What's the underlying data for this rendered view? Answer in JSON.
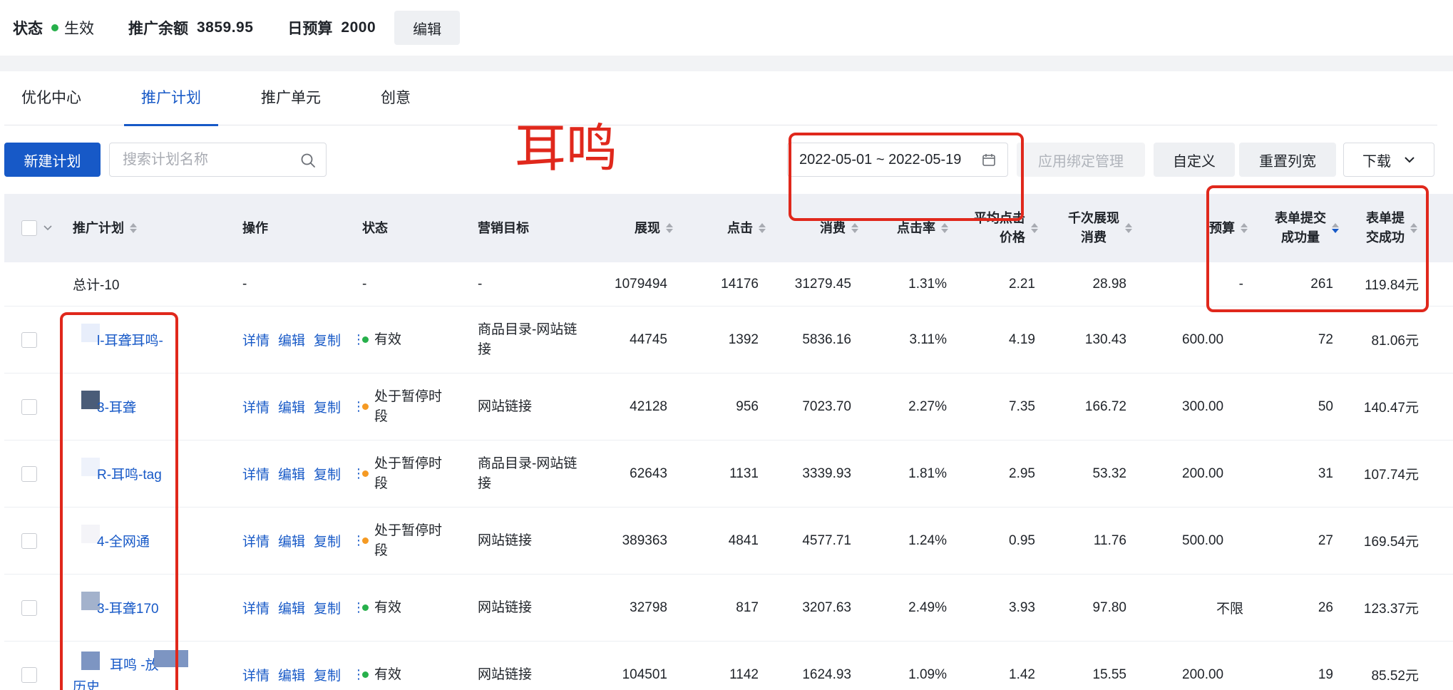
{
  "topbar": {
    "status_label": "状态",
    "status_value": "生效",
    "balance_label": "推广余额",
    "balance_value": "3859.95",
    "budget_label": "日预算",
    "budget_value": "2000",
    "edit_label": "编辑"
  },
  "tabs": [
    "优化中心",
    "推广计划",
    "推广单元",
    "创意"
  ],
  "toolbar": {
    "new_plan": "新建计划",
    "search_placeholder": "搜索计划名称",
    "date_range": "2022-05-01 ~ 2022-05-19",
    "app_binding": "应用绑定管理",
    "customize": "自定义",
    "reset_width": "重置列宽",
    "download": "下载"
  },
  "annotation": "耳鸣",
  "columns": {
    "plan": "推广计划",
    "ops": "操作",
    "status": "状态",
    "goal": "营销目标",
    "impressions": "展现",
    "clicks": "点击",
    "cost": "消费",
    "ctr": "点击率",
    "cpc_1": "平均点击",
    "cpc_2": "价格",
    "cpm_1": "千次展现",
    "cpm_2": "消费",
    "budget": "预算",
    "conv_1": "表单提交",
    "conv_2": "成功量",
    "cpa_1": "表单提",
    "cpa_2": "交成功"
  },
  "total": {
    "name": "总计-10",
    "ops": "-",
    "status": "-",
    "goal": "-",
    "impressions": "1079494",
    "clicks": "14176",
    "cost": "31279.45",
    "ctr": "1.31%",
    "cpc": "2.21",
    "cpm": "28.98",
    "budget": "-",
    "conv": "261",
    "cpa": "119.84元"
  },
  "ops_links": [
    "详情",
    "编辑",
    "复制"
  ],
  "rows": [
    {
      "name": "l-耳聋耳鸣-",
      "status": "有效",
      "status_color": "green",
      "goal": "商品目录-网站链接",
      "impressions": "44745",
      "clicks": "1392",
      "cost": "5836.16",
      "ctr": "3.11%",
      "cpc": "4.19",
      "cpm": "130.43",
      "budget": "600.00",
      "conv": "72",
      "cpa": "81.06元"
    },
    {
      "name": "3-耳聋",
      "status": "处于暂停时段",
      "status_color": "orange",
      "goal": "网站链接",
      "impressions": "42128",
      "clicks": "956",
      "cost": "7023.70",
      "ctr": "2.27%",
      "cpc": "7.35",
      "cpm": "166.72",
      "budget": "300.00",
      "conv": "50",
      "cpa": "140.47元"
    },
    {
      "name": "R-耳鸣-tag",
      "status": "处于暂停时段",
      "status_color": "orange",
      "goal": "商品目录-网站链接",
      "impressions": "62643",
      "clicks": "1131",
      "cost": "3339.93",
      "ctr": "1.81%",
      "cpc": "2.95",
      "cpm": "53.32",
      "budget": "200.00",
      "conv": "31",
      "cpa": "107.74元"
    },
    {
      "name": "4-全网通",
      "status": "处于暂停时段",
      "status_color": "orange",
      "goal": "网站链接",
      "impressions": "389363",
      "clicks": "4841",
      "cost": "4577.71",
      "ctr": "1.24%",
      "cpc": "0.95",
      "cpm": "11.76",
      "budget": "500.00",
      "conv": "27",
      "cpa": "169.54元"
    },
    {
      "name": "3-耳聋170",
      "status": "有效",
      "status_color": "green",
      "goal": "网站链接",
      "impressions": "32798",
      "clicks": "817",
      "cost": "3207.63",
      "ctr": "2.49%",
      "cpc": "3.93",
      "cpm": "97.80",
      "budget": "不限",
      "conv": "26",
      "cpa": "123.37元"
    },
    {
      "name": "耳鸣 -放",
      "name_2": "历史",
      "status": "有效",
      "status_color": "green",
      "goal": "网站链接",
      "impressions": "104501",
      "clicks": "1142",
      "cost": "1624.93",
      "ctr": "1.09%",
      "cpc": "1.42",
      "cpm": "15.55",
      "budget": "200.00",
      "conv": "19",
      "cpa": "85.52元"
    }
  ],
  "colors": {
    "primary": "#1759c7",
    "annotation_red": "#e0281c",
    "active_green": "#27b04b",
    "paused_orange": "#f59a23",
    "header_bg": "#eef0f5"
  }
}
